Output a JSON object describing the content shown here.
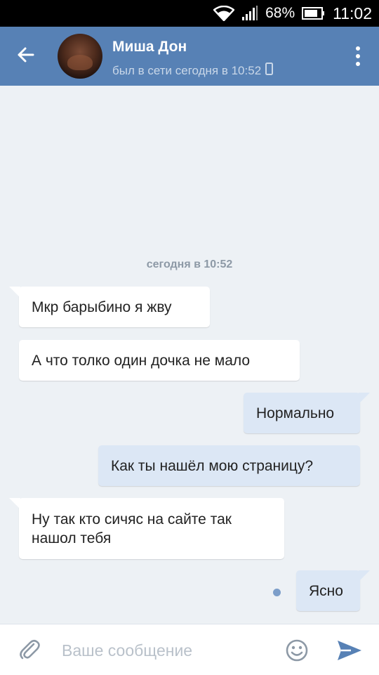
{
  "status_bar": {
    "battery_percent": "68%",
    "time": "11:02"
  },
  "header": {
    "contact_name": "Миша Дон",
    "last_seen": "был в сети сегодня в 10:52",
    "accent_color": "#5781b5"
  },
  "chat": {
    "date_separator": "сегодня в 10:52",
    "messages": [
      {
        "direction": "incoming",
        "text": "Мкр барыбино я жву"
      },
      {
        "direction": "incoming",
        "text": "А что толко один дочка не мало"
      },
      {
        "direction": "outgoing",
        "text": "Нормально"
      },
      {
        "direction": "outgoing",
        "text": "Как ты нашёл мою страницу?"
      },
      {
        "direction": "incoming",
        "text": "Ну так кто сичяс на сайте так нашол тебя"
      },
      {
        "direction": "outgoing",
        "text": "Ясно",
        "unread": true
      }
    ]
  },
  "composer": {
    "placeholder": "Ваше сообщение",
    "value": ""
  },
  "icons": {
    "back": "arrow-left-icon",
    "menu": "vertical-dots-icon",
    "mobile": "mobile-phone-icon",
    "attach": "paperclip-icon",
    "emoji": "smiley-icon",
    "send": "send-arrow-icon"
  }
}
